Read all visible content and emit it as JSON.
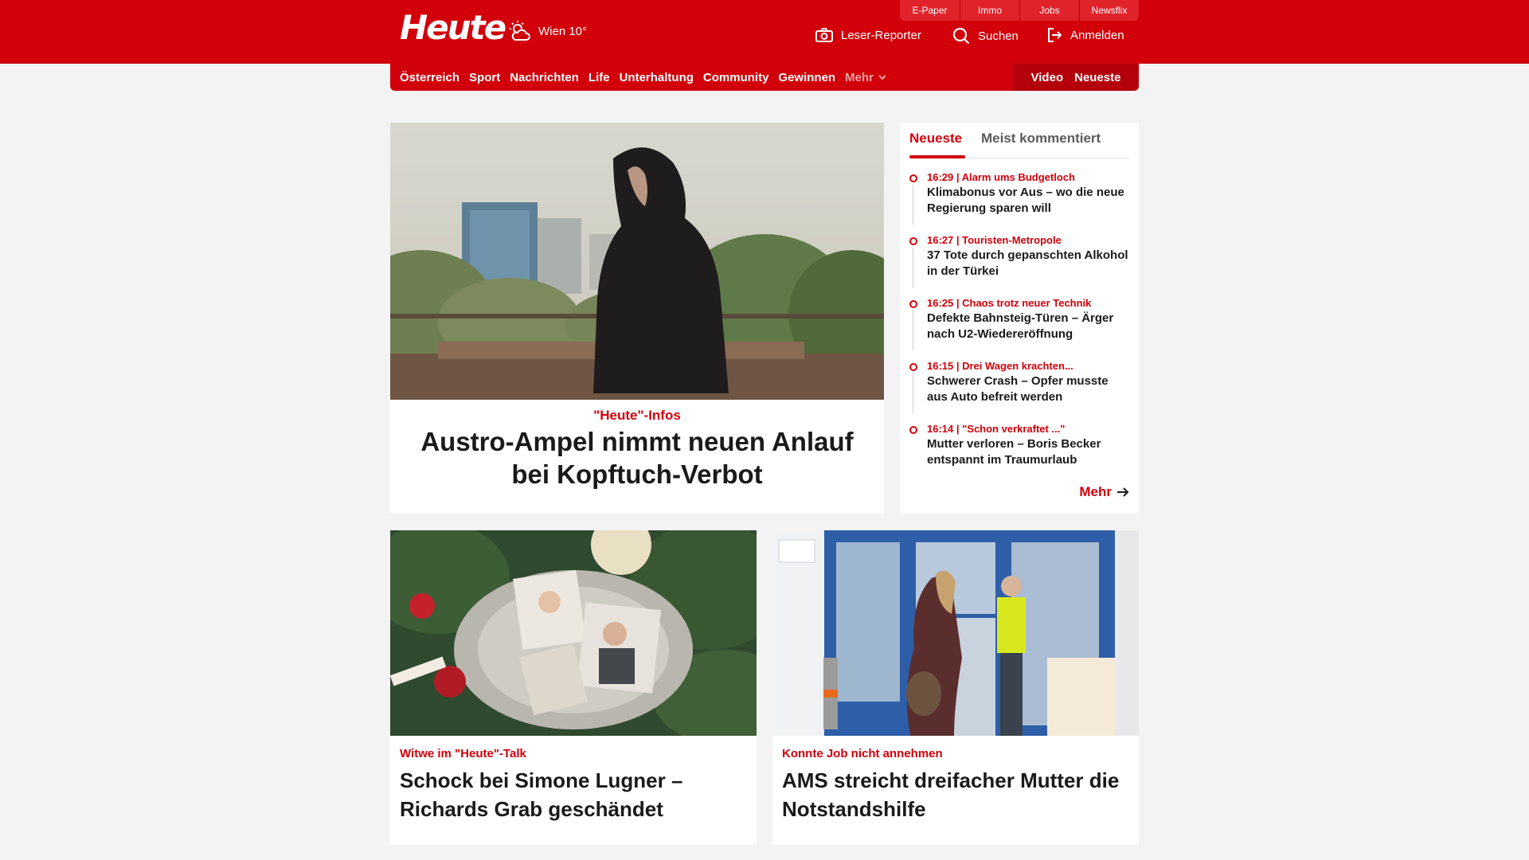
{
  "header": {
    "logo": "Heute",
    "weather": {
      "location": "Wien 10°",
      "icon": "partly-cloudy-icon"
    },
    "quick_links": [
      "E-Paper",
      "Immo",
      "Jobs",
      "Newsflix"
    ],
    "actions": {
      "reporter": "Leser-Reporter",
      "search": "Suchen",
      "login": "Anmelden"
    }
  },
  "nav": {
    "items": [
      "Österreich",
      "Sport",
      "Nachrichten",
      "Life",
      "Unterhaltung",
      "Community",
      "Gewinnen"
    ],
    "more": "Mehr",
    "right": [
      "Video",
      "Neueste"
    ]
  },
  "hero": {
    "kicker": "\"Heute\"-Infos",
    "title": "Austro-Ampel nimmt neuen Anlauf bei Kopftuch-Verbot"
  },
  "sidebar": {
    "tabs": [
      "Neueste",
      "Meist kommentiert"
    ],
    "items": [
      {
        "meta": "16:29 | Alarm ums Budgetloch",
        "title": "Klimabonus vor Aus – wo die neue Regierung sparen will"
      },
      {
        "meta": "16:27 | Touristen-Metropole",
        "title": "37 Tote durch gepanschten Alkohol in der Türkei"
      },
      {
        "meta": "16:25 | Chaos trotz neuer Technik",
        "title": "Defekte Bahnsteig-Türen – Ärger nach U2-Wiedereröffnung"
      },
      {
        "meta": "16:15 | Drei Wagen krachten...",
        "title": "Schwerer Crash – Opfer musste aus Auto befreit werden"
      },
      {
        "meta": "16:14 | \"Schon verkraftet ...\"",
        "title": "Mutter verloren – Boris Becker entspannt im Traumurlaub"
      }
    ],
    "more": "Mehr"
  },
  "cards": [
    {
      "kicker": "Witwe im \"Heute\"-Talk",
      "title": "Schock bei Simone Lugner – Richards Grab geschändet"
    },
    {
      "kicker": "Konnte Job nicht annehmen",
      "title": "AMS streicht dreifacher Mutter die Notstandshilfe"
    }
  ],
  "colors": {
    "brand": "#d1000a",
    "brand_dark": "#b3000a",
    "background": "#f3f3f3"
  }
}
